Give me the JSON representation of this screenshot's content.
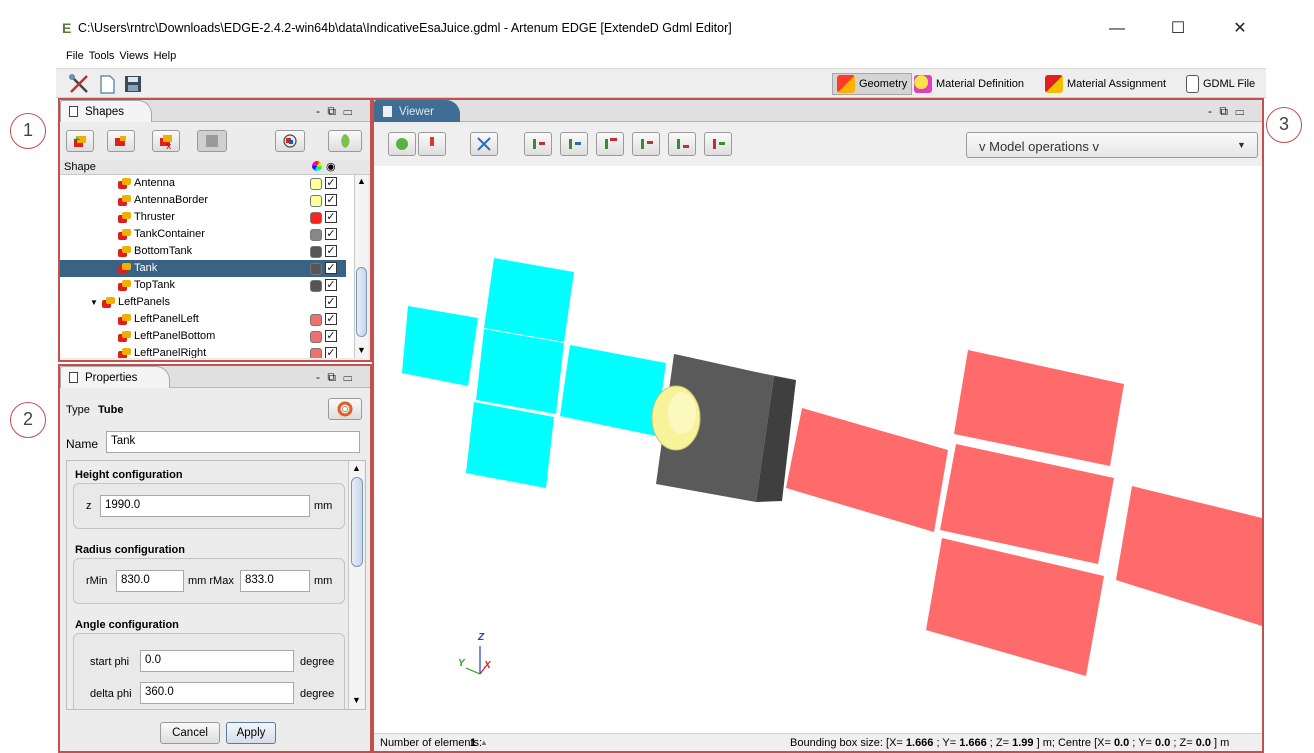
{
  "window": {
    "title": "C:\\Users\\rntrc\\Downloads\\EDGE-2.4.2-win64b\\data\\IndicativeEsaJuice.gdml - Artenum EDGE [ExtendeD Gdml Editor]",
    "logo_glyph": "E",
    "minimize": "—",
    "maximize": "☐",
    "close": "✕"
  },
  "menu": [
    "File",
    "Tools",
    "Views",
    "Help"
  ],
  "modes": {
    "geometry": "Geometry",
    "material_definition": "Material Definition",
    "material_assignment": "Material Assignment",
    "gdml_file": "GDML File"
  },
  "callouts": [
    "1",
    "2",
    "3"
  ],
  "shapes_panel": {
    "tab_label": "Shapes",
    "header_col": "Shape",
    "controls": "- ⧉ ▭",
    "rows": [
      {
        "label": "Antenna",
        "indent": 3,
        "color": "#ffff99",
        "checked": true,
        "selected": false
      },
      {
        "label": "AntennaBorder",
        "indent": 3,
        "color": "#ffff99",
        "checked": true,
        "selected": false
      },
      {
        "label": "Thruster",
        "indent": 3,
        "color": "#ff2020",
        "checked": true,
        "selected": false
      },
      {
        "label": "TankContainer",
        "indent": 3,
        "color": "#888888",
        "checked": true,
        "selected": false
      },
      {
        "label": "BottomTank",
        "indent": 3,
        "color": "#555555",
        "checked": true,
        "selected": false
      },
      {
        "label": "Tank",
        "indent": 3,
        "color": "#555555",
        "checked": true,
        "selected": true
      },
      {
        "label": "TopTank",
        "indent": 3,
        "color": "#555555",
        "checked": true,
        "selected": false
      },
      {
        "label": "LeftPanels",
        "indent": 2,
        "color": "",
        "checked": true,
        "selected": false,
        "expander": "▼"
      },
      {
        "label": "LeftPanelLeft",
        "indent": 3,
        "color": "#f07070",
        "checked": true,
        "selected": false
      },
      {
        "label": "LeftPanelBottom",
        "indent": 3,
        "color": "#f07070",
        "checked": true,
        "selected": false
      },
      {
        "label": "LeftPanelRight",
        "indent": 3,
        "color": "#f07070",
        "checked": true,
        "selected": false
      }
    ]
  },
  "properties_panel": {
    "tab_label": "Properties",
    "controls": "- ⧉ ▭",
    "type_label": "Type",
    "type_value": "Tube",
    "name_label": "Name",
    "name_value": "Tank",
    "height": {
      "title": "Height configuration",
      "z_label": "z",
      "z_value": "1990.0",
      "unit": "mm"
    },
    "radius": {
      "title": "Radius configuration",
      "rmin_label": "rMin",
      "rmin_value": "830.0",
      "mid_label": "mm rMax",
      "rmax_value": "833.0",
      "unit": "mm"
    },
    "angle": {
      "title": "Angle configuration",
      "start_label": "start phi",
      "start_value": "0.0",
      "delta_label": "delta phi",
      "delta_value": "360.0",
      "unit": "degree"
    },
    "cancel": "Cancel",
    "apply": "Apply"
  },
  "viewer_panel": {
    "tab_label": "Viewer",
    "controls": "- ⧉ ▭",
    "model_ops": "v Model operations v",
    "status_left_label": "Number of elements:",
    "status_left_value": "1",
    "status_left_arrow": "▲",
    "status_right": {
      "p1": "Bounding box size: [X= ",
      "x": "1.666",
      "p2": " ; Y= ",
      "y": "1.666",
      "p3": " ; Z= ",
      "z": "1.99",
      "p4": " ] m;  Centre [X= ",
      "cx": "0.0",
      "p5": " ; Y= ",
      "cy": "0.0",
      "p6": " ; Z= ",
      "cz": "0.0",
      "p7": " ] m"
    },
    "axes": {
      "z": "Z",
      "y": "Y",
      "x": "X"
    }
  },
  "colors": {
    "frame": "#c2504f",
    "selection": "#3a6285",
    "cyan_panel": "#00ffff",
    "red_panel": "#ff6b6b",
    "body": "#5a5a5a",
    "antenna": "#ffff99"
  }
}
